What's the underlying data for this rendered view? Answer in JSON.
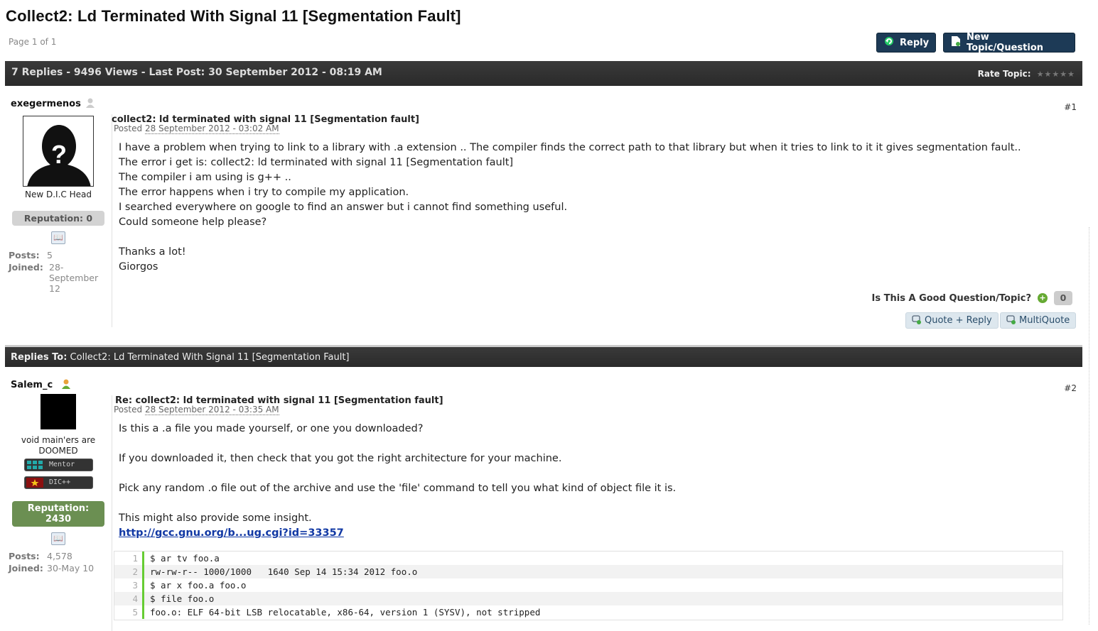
{
  "page": {
    "title": "Collect2: Ld Terminated With Signal 11 [Segmentation Fault]",
    "page_info": "Page 1 of 1",
    "reply_label": "Reply",
    "new_topic_label": "New Topic/Question",
    "stats": "7 Replies - 9496 Views - Last Post: 30 September 2012 - 08:19 AM",
    "rate_label": "Rate Topic:",
    "rate_stars": "★★★★★"
  },
  "post1": {
    "username": "exegermenos",
    "number": "#1",
    "group": "New D.I.C Head",
    "reputation": "Reputation: 0",
    "posts_label": "Posts:",
    "posts_value": "5",
    "joined_label": "Joined:",
    "joined_value": "28-\nSeptember\n12",
    "title": "collect2: ld terminated with signal 11 [Segmentation fault]",
    "posted_prefix": "Posted",
    "posted_date": "28 September 2012 - 03:02 AM",
    "lines": [
      "I have a problem when trying to link to a library with .a extension .. The compiler finds the correct path to that library but when it tries to link to it it gives segmentation fault..",
      "The error i get is: collect2: ld terminated with signal 11 [Segmentation fault]",
      "The compiler i am using is g++ ..",
      "The error happens when i try to compile my application.",
      "I searched everywhere on google to find an answer but i cannot find something useful.",
      "Could someone help please?",
      "",
      "Thanks a lot!",
      "Giorgos"
    ],
    "good_question": "Is This A Good Question/Topic?",
    "good_count": "0",
    "quote_reply": "Quote + Reply",
    "multiquote": "MultiQuote"
  },
  "replies_bar": {
    "label": "Replies To:",
    "title": "Collect2: Ld Terminated With Signal 11 [Segmentation Fault]"
  },
  "post2": {
    "username": "Salem_c",
    "number": "#2",
    "group_line1": "void main'ers are",
    "group_line2": "DOOMED",
    "badge1": "Mentor",
    "badge2": "DIC++",
    "reputation_label": "Reputation:",
    "reputation_value": "2430",
    "posts_label": "Posts:",
    "posts_value": "4,578",
    "joined_label": "Joined:",
    "joined_value": "30-May 10",
    "title": "Re: collect2: ld terminated with signal 11 [Segmentation fault]",
    "posted_prefix": "Posted",
    "posted_date": "28 September 2012 - 03:35 AM",
    "lines": [
      "Is this a .a file you made yourself, or one you downloaded?",
      "",
      "If you downloaded it, then check that you got the right architecture for your machine.",
      "",
      "Pick any random .o file out of the archive and use the 'file' command to tell you what kind of object file it is.",
      "",
      "This might also provide some insight."
    ],
    "link": "http://gcc.gnu.org/b...ug.cgi?id=33357",
    "code": [
      {
        "n": "1",
        "t": "$ ar tv foo.a"
      },
      {
        "n": "2",
        "t": "rw-rw-r-- 1000/1000   1640 Sep 14 15:34 2012 foo.o"
      },
      {
        "n": "3",
        "t": "$ ar x foo.a foo.o"
      },
      {
        "n": "4",
        "t": "$ file foo.o"
      },
      {
        "n": "5",
        "t": "foo.o: ELF 64-bit LSB relocatable, x86-64, version 1 (SYSV), not stripped"
      }
    ]
  },
  "colors": {
    "button_bg": "#1d3a56",
    "bar_bg": "#2f2f2f",
    "rep_green": "#6b8f52",
    "link": "#1138a4"
  },
  "icons": {
    "reply": "reply-arrow-icon",
    "new_topic": "new-document-icon",
    "user_offline": "user-offline-icon",
    "user_online": "user-online-icon",
    "profile": "book-icon",
    "plus": "plus-icon",
    "quote": "quote-icon"
  }
}
